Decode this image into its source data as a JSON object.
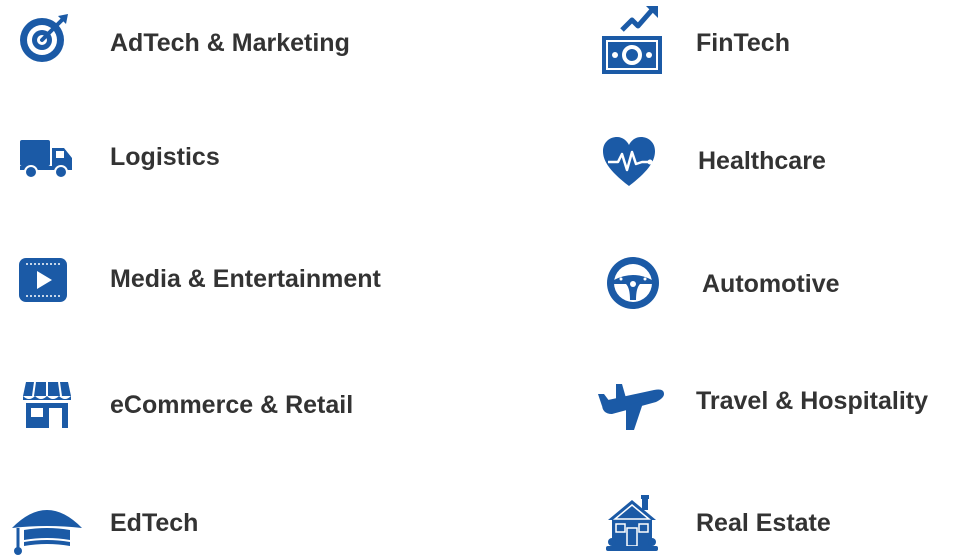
{
  "accent_color": "#1b5aa6",
  "text_color": "#333333",
  "industries": [
    {
      "label": "AdTech & Marketing",
      "icon": "target-icon"
    },
    {
      "label": "Logistics",
      "icon": "truck-icon"
    },
    {
      "label": "Media & Entertainment",
      "icon": "play-icon"
    },
    {
      "label": "eCommerce & Retail",
      "icon": "storefront-icon"
    },
    {
      "label": "EdTech",
      "icon": "graduation-cap-icon"
    },
    {
      "label": "FinTech",
      "icon": "money-growth-icon"
    },
    {
      "label": "Healthcare",
      "icon": "heart-pulse-icon"
    },
    {
      "label": "Automotive",
      "icon": "steering-wheel-icon"
    },
    {
      "label": "Travel & Hospitality",
      "icon": "airplane-icon"
    },
    {
      "label": "Real Estate",
      "icon": "house-icon"
    }
  ]
}
